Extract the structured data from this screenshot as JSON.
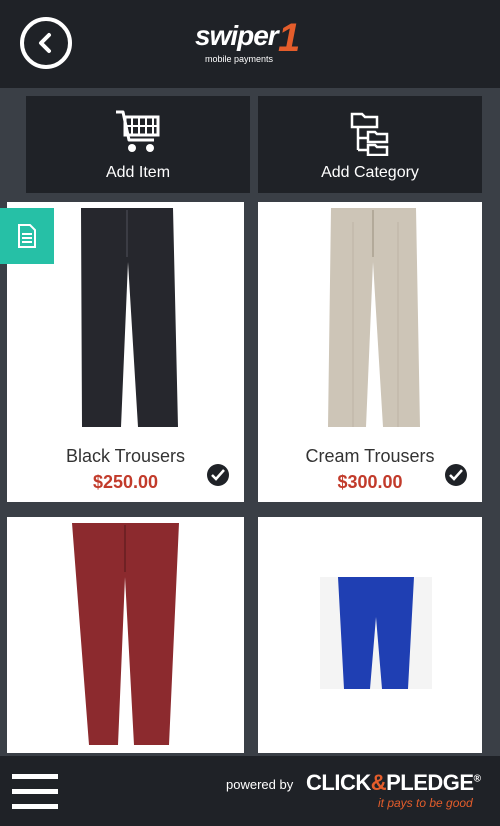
{
  "header": {
    "logo_text": "swiper",
    "logo_number": "1",
    "logo_sub": "mobile payments"
  },
  "actions": {
    "add_item": "Add Item",
    "add_category": "Add Category"
  },
  "products": [
    {
      "name": "Black Trousers",
      "price": "$250.00",
      "color": "#26272d",
      "selected": true
    },
    {
      "name": "Cream Trousers",
      "price": "$300.00",
      "color": "#cdc5b7",
      "selected": true
    },
    {
      "name": "",
      "price": "",
      "color": "#8c2a2e",
      "selected": false
    },
    {
      "name": "",
      "price": "",
      "color": "#1f3fb3",
      "selected": false
    }
  ],
  "footer": {
    "powered_by": "powered by",
    "brand_left": "CLICK",
    "brand_amp": "&",
    "brand_right": "PLEDGE",
    "brand_reg": "®",
    "tagline": "it pays to be good"
  },
  "colors": {
    "accent": "#26c0a6",
    "price": "#c23b2b",
    "brand_orange": "#e45d2b"
  }
}
